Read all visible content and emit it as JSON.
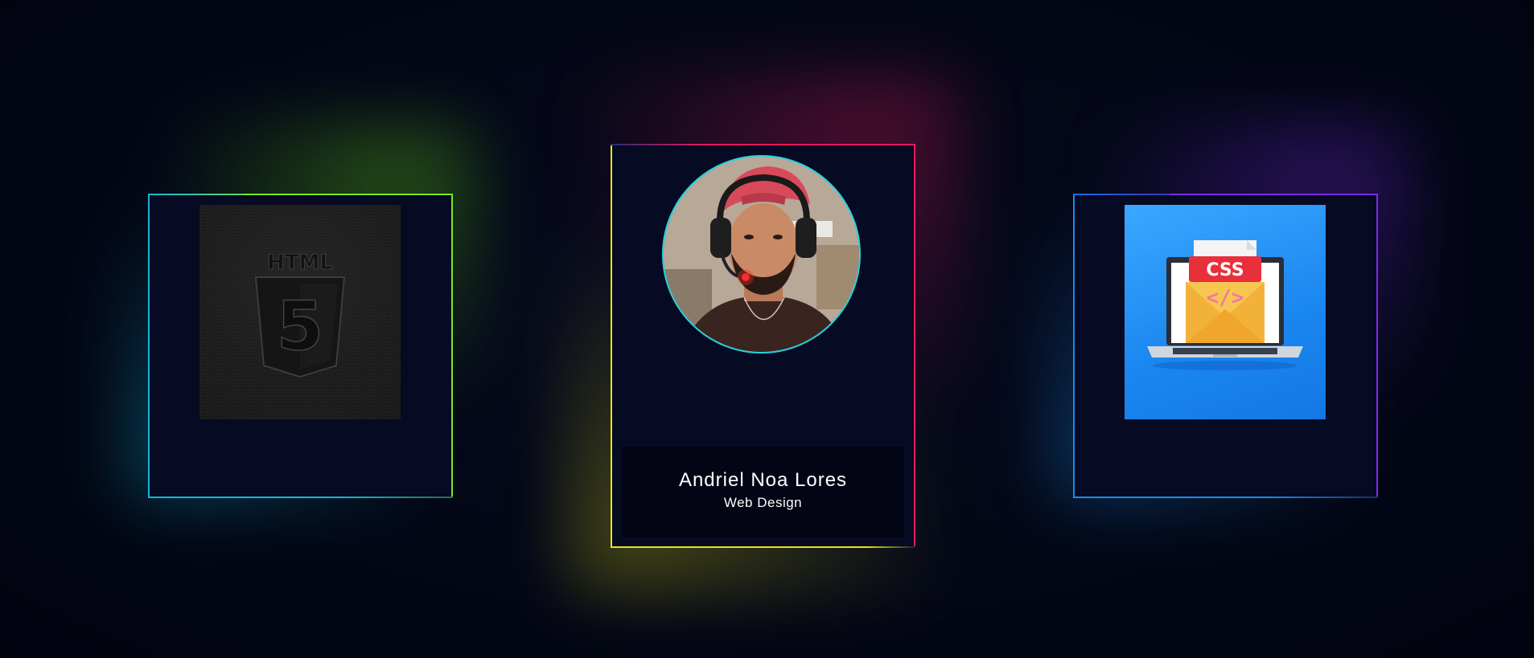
{
  "theme": {
    "background": "#020614",
    "card_background": "#060a22",
    "left_card_colors": [
      "#7ee81a",
      "#12b7d6"
    ],
    "center_card_colors": [
      "#e81a5c",
      "#e8e21a"
    ],
    "right_card_colors": [
      "#7a2ae8",
      "#1a8ce8"
    ],
    "avatar_ring": "#22d3e0"
  },
  "cards": [
    {
      "id": "html",
      "image": "html5-logo-icon",
      "image_text": "HTML",
      "image_number": "5"
    },
    {
      "id": "profile",
      "image": "profile-photo",
      "name": "Andriel Noa Lores",
      "role": "Web Design"
    },
    {
      "id": "css",
      "image": "css-laptop-envelope-icon",
      "image_text": "CSS",
      "image_code": "</>"
    }
  ]
}
